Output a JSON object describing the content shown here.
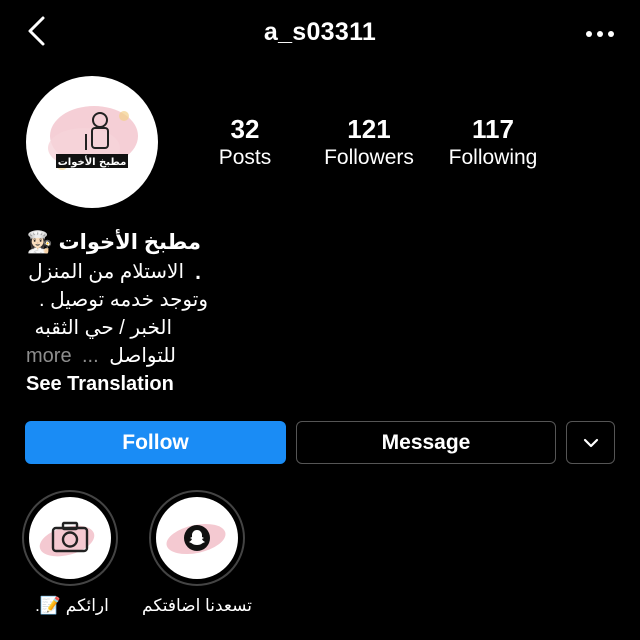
{
  "header": {
    "username": "a_s03311"
  },
  "stats": [
    {
      "count": "32",
      "label": "Posts"
    },
    {
      "count": "121",
      "label": "Followers"
    },
    {
      "count": "117",
      "label": "Following"
    }
  ],
  "bio": {
    "name": "مطبخ الأخوات 👩🏻‍🍳 .",
    "lines": [
      "الاستلام من المنزل",
      "وتوجد خدمه توصيل .",
      "الخبر / حي الثقبه",
      "للتواصل"
    ],
    "ellipsis": "...",
    "more_label": "more",
    "translate_label": "See Translation"
  },
  "actions": {
    "follow_label": "Follow",
    "message_label": "Message"
  },
  "highlights": [
    {
      "label": "ارائكم 📝.",
      "icon": "camera-icon"
    },
    {
      "label": "تسعدنا اضافتكم",
      "icon": "snapchat-icon"
    }
  ],
  "avatar_text": "مطبخ الأخوات",
  "colors": {
    "background": "#000000",
    "follow_button": "#1A8CF5",
    "muted_text": "#8E8E8E",
    "border": "#555555"
  }
}
